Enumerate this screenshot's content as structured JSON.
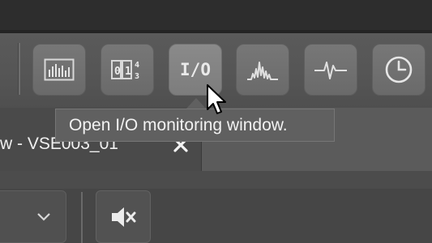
{
  "toolbar": {
    "buttons": [
      {
        "name": "bar-chart-icon",
        "label": ""
      },
      {
        "name": "numeric-display-icon",
        "label": ""
      },
      {
        "name": "io-monitor-icon",
        "label": "I/O"
      },
      {
        "name": "spectrum-icon",
        "label": ""
      },
      {
        "name": "waveform-icon",
        "label": ""
      },
      {
        "name": "clock-icon",
        "label": ""
      }
    ]
  },
  "tooltip": {
    "text": "Open I/O monitoring window."
  },
  "tab": {
    "title": "w - VSE003_01"
  },
  "colors": {
    "toolbar_bg": "#555555",
    "button_bg": "#6a6a6a",
    "tooltip_bg": "#606060",
    "text": "#f0f0f0"
  }
}
